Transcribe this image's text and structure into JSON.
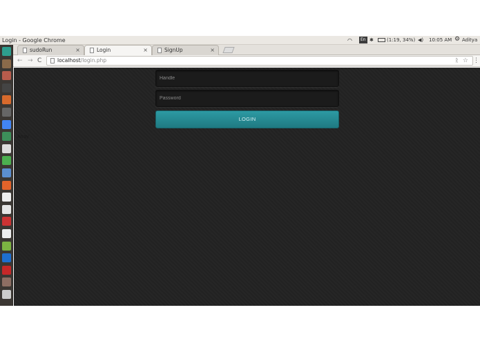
{
  "window": {
    "title": "Login - Google Chrome"
  },
  "system_tray": {
    "language": "En",
    "battery": "(1:19, 34%)",
    "time": "10:05 AM",
    "user": "Aditya"
  },
  "tabs": [
    {
      "label": "sudoRun",
      "close": "×",
      "active": false
    },
    {
      "label": "Login",
      "close": "×",
      "active": true
    },
    {
      "label": "SignUp",
      "close": "×",
      "active": false
    }
  ],
  "toolbar": {
    "back_icon": "←",
    "forward_icon": "→",
    "reload_icon": "C",
    "url_host": "localhost",
    "url_path": "/login.php",
    "menu_icon": "⋮"
  },
  "form": {
    "handle_placeholder": "Handle",
    "password_placeholder": "Password",
    "login_label": "LOGIN"
  },
  "page": {
    "stray_text": "Array"
  },
  "launcher_icons": [
    "dash-icon",
    "files-icon",
    "archive-icon",
    "terminal-icon",
    "firefox-icon",
    "text-editor-icon",
    "chrome-icon",
    "sublime-icon",
    "document-icon",
    "spreadsheet-icon",
    "writer-icon",
    "software-center-icon",
    "text-file-icon",
    "amazon-icon",
    "tools-icon",
    "calendar-icon",
    "android-icon",
    "bluetooth-icon",
    "app-icon",
    "drive-icon",
    "printer-icon"
  ],
  "colors": {
    "accent": "#2a939b",
    "page_bg": "#232323"
  }
}
